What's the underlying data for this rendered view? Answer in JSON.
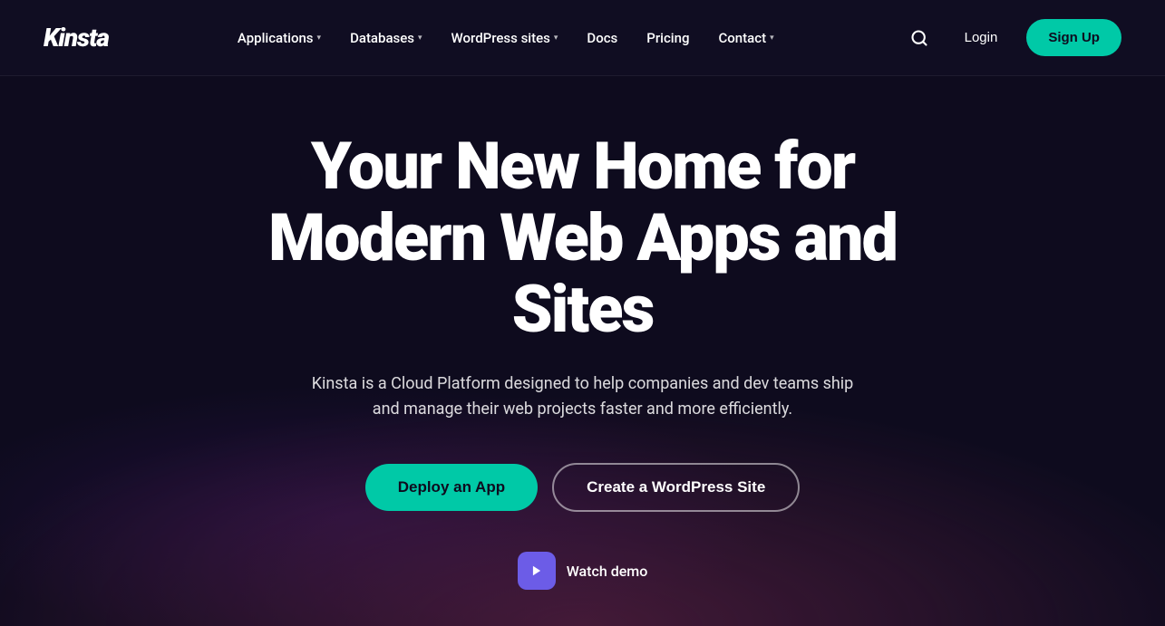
{
  "brand": {
    "logo": "Kinsta"
  },
  "nav": {
    "links": [
      {
        "label": "Applications",
        "has_dropdown": true
      },
      {
        "label": "Databases",
        "has_dropdown": true
      },
      {
        "label": "WordPress sites",
        "has_dropdown": true
      },
      {
        "label": "Docs",
        "has_dropdown": false
      },
      {
        "label": "Pricing",
        "has_dropdown": false
      },
      {
        "label": "Contact",
        "has_dropdown": true
      }
    ],
    "login_label": "Login",
    "signup_label": "Sign Up",
    "search_aria": "Search"
  },
  "hero": {
    "title": "Your New Home for Modern Web Apps and Sites",
    "subtitle": "Kinsta is a Cloud Platform designed to help companies and dev teams ship and manage their web projects faster and more efficiently.",
    "btn_deploy": "Deploy an App",
    "btn_wordpress": "Create a WordPress Site",
    "watch_demo_label": "Watch demo"
  }
}
